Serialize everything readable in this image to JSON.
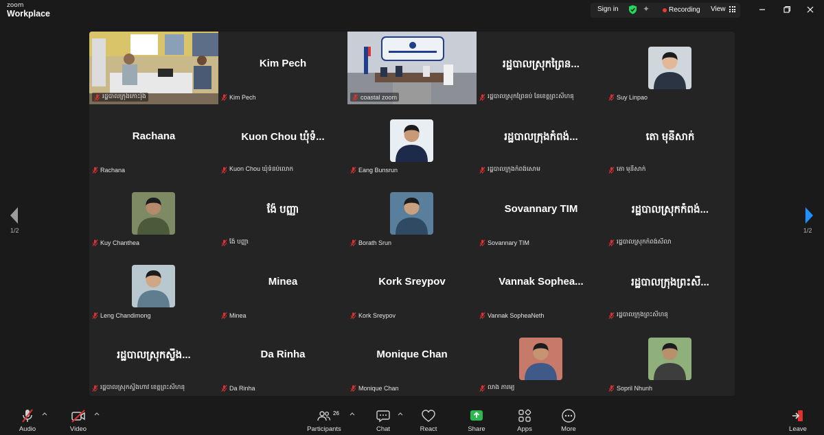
{
  "app": {
    "brand_top": "zoom",
    "brand_bottom": "Workplace",
    "sign_in": "Sign in",
    "recording": "Recording",
    "view": "View"
  },
  "pagination": {
    "left": "1/2",
    "right": "1/2"
  },
  "tiles": [
    {
      "big": "",
      "label": "រដ្ឋបាលក្រុងកោះរ៉ុង",
      "video": true
    },
    {
      "big": "Kim Pech",
      "label": "Kim Pech"
    },
    {
      "big": "",
      "label": "coastal zoom",
      "video": true,
      "active": true
    },
    {
      "big": "រដ្ឋបាលស្រុកព្រៃន...",
      "label": "រដ្ឋបាលស្រុកព្រៃនប់ នៃខេត្តព្រះសីហនុ"
    },
    {
      "big": "",
      "label": "Suy Linpao",
      "avatar": true
    },
    {
      "big": "Rachana",
      "label": "Rachana"
    },
    {
      "big": "Kuon Chou ឃុំទំ...",
      "label": "Kuon Chou ឃុំទំនប់លោក"
    },
    {
      "big": "",
      "label": "Eang Bunsrun",
      "avatar": true
    },
    {
      "big": "រដ្ឋបាលក្រុងកំពង់...",
      "label": "រដ្ឋបាលក្រុងកំពង់សោម"
    },
    {
      "big": "តោ មុនីសាក់",
      "label": "តោ មុនីសាក់"
    },
    {
      "big": "",
      "label": "Kuy Chanthea",
      "avatar": true
    },
    {
      "big": "ង៉ែ បញ្ញា",
      "label": "ង៉ែ បញ្ញា"
    },
    {
      "big": "",
      "label": "Borath Srun",
      "avatar": true
    },
    {
      "big": "Sovannary TIM",
      "label": "Sovannary TIM"
    },
    {
      "big": "រដ្ឋបាលស្រុកកំពង់...",
      "label": "រដ្ឋបាលស្រុកកំពង់សីលា"
    },
    {
      "big": "",
      "label": "Leng Chandimong",
      "avatar": true
    },
    {
      "big": "Minea",
      "label": "Minea"
    },
    {
      "big": "Kork Sreypov",
      "label": "Kork Sreypov"
    },
    {
      "big": "Vannak Sophea...",
      "label": "Vannak SopheaNeth"
    },
    {
      "big": "រដ្ឋបាលក្រុងព្រះសី...",
      "label": "រដ្ឋបាលក្រុងព្រះសីហនុ"
    },
    {
      "big": "រដ្ឋបាលស្រុកស្ទឹង...",
      "label": "រដ្ឋបាលស្រុកស្ទឹងហាវ ខេត្តព្រះសីហនុ"
    },
    {
      "big": "Da Rinha",
      "label": "Da Rinha"
    },
    {
      "big": "Monique Chan",
      "label": "Monique Chan"
    },
    {
      "big": "",
      "label": "លាង ភារម្យ",
      "avatar": true
    },
    {
      "big": "",
      "label": "Sopril Nhunh",
      "avatar": true
    }
  ],
  "toolbar": {
    "audio": "Audio",
    "video": "Video",
    "participants": "Participants",
    "participants_count": "26",
    "chat": "Chat",
    "react": "React",
    "share": "Share",
    "apps": "Apps",
    "more": "More",
    "leave": "Leave"
  },
  "colors": {
    "accent_green": "#23d959",
    "share_green": "#2db84f",
    "muted_red": "#e03131",
    "arrow_blue": "#1e90ff"
  }
}
